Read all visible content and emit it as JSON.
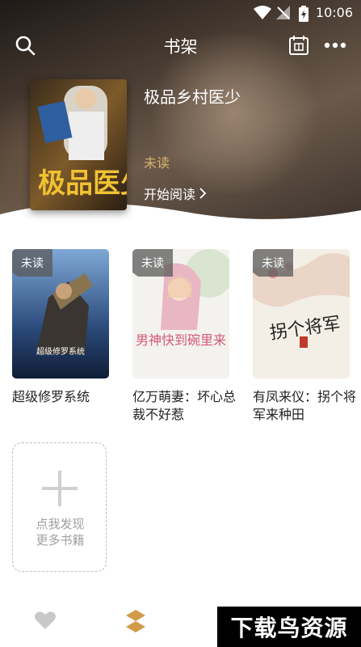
{
  "status_bar": {
    "time": "10:06"
  },
  "header": {
    "title": "书架"
  },
  "hero": {
    "title": "极品乡村医少",
    "status": "未读",
    "action": "开始阅读",
    "cover_text": "极品医少"
  },
  "books": [
    {
      "badge": "未读",
      "title": "超级修罗系统",
      "cover_text": "超级修罗系统"
    },
    {
      "badge": "未读",
      "title": "亿万萌妻：坏心总裁不好惹",
      "cover_text": "男神快到碗里来"
    },
    {
      "badge": "未读",
      "title": "有凤来仪：拐个将军来种田",
      "cover_text": "拐个将军"
    }
  ],
  "discover": {
    "line1": "点我发现",
    "line2": "更多书籍"
  },
  "watermark": "下载鸟资源"
}
